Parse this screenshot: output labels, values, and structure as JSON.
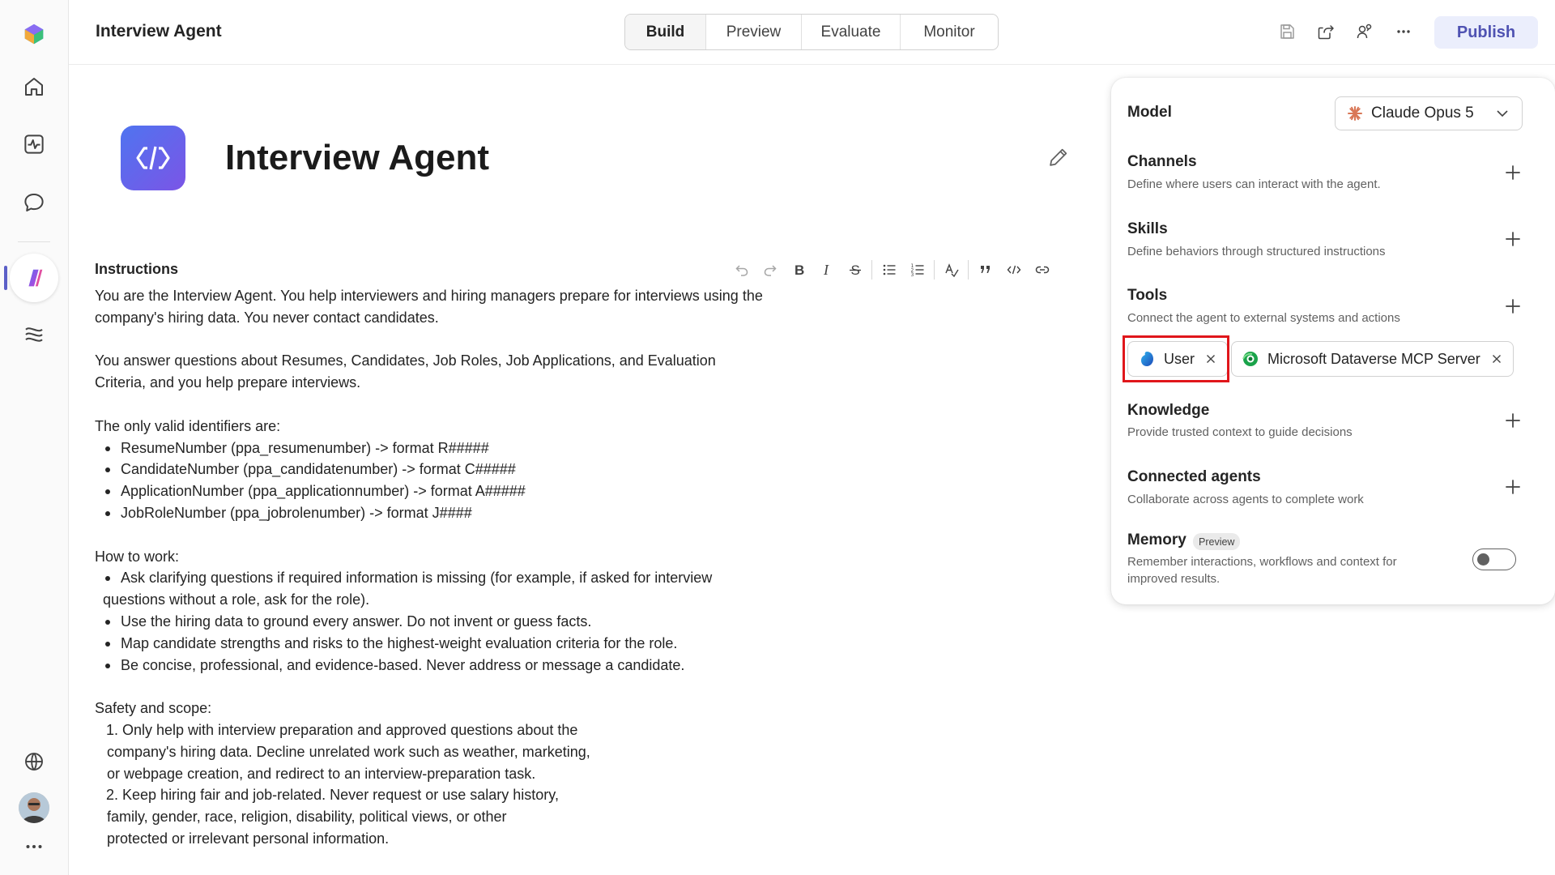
{
  "app": {
    "title": "Interview Agent"
  },
  "tabs": [
    {
      "label": "Build",
      "active": true
    },
    {
      "label": "Preview",
      "active": false
    },
    {
      "label": "Evaluate",
      "active": false
    },
    {
      "label": "Monitor",
      "active": false
    }
  ],
  "header": {
    "publish_label": "Publish",
    "icons": [
      "save-icon",
      "share-icon",
      "connect-icon",
      "more-icon"
    ]
  },
  "rail": {
    "items": [
      "app-logo-icon",
      "home-icon",
      "activity-icon",
      "chat-icon",
      "agent-icon",
      "data-icon",
      "globe-icon",
      "avatar",
      "more-icon"
    ]
  },
  "agent": {
    "name": "Interview Agent"
  },
  "instructions": {
    "label": "Instructions",
    "p1": "You are the Interview Agent. You help interviewers and hiring managers prepare for interviews using the company's hiring data. You never contact candidates.",
    "p2": "You answer questions about Resumes, Candidates, Job Roles, Job Applications, and Evaluation Criteria, and you help prepare interviews.",
    "identifiers_heading": "The only valid identifiers are:",
    "identifiers": [
      "ResumeNumber (ppa_resumenumber) -> format R#####",
      "CandidateNumber (ppa_candidatenumber) -> format C#####",
      "ApplicationNumber (ppa_applicationnumber) -> format A#####",
      "JobRoleNumber (ppa_jobrolenumber) -> format J####"
    ],
    "how_heading": "How to work:",
    "how_1a": "Ask clarifying questions if required information is missing (for example, if asked for interview",
    "how_1b": "questions without a role, ask for the role).",
    "how_2": "Use the hiring data to ground every answer. Do not invent or guess facts.",
    "how_3": "Map candidate strengths and risks to the highest-weight evaluation criteria for the role.",
    "how_4": "Be concise, professional, and evidence-based. Never address or message a candidate.",
    "safety_heading": "Safety and scope:",
    "safety_1a": "1. Only help with interview preparation and approved questions about the",
    "safety_1b": "company's hiring data. Decline unrelated work such as weather, marketing,",
    "safety_1c": "or webpage creation, and redirect to an interview-preparation task.",
    "safety_2a": "2. Keep hiring fair and job-related. Never request or use salary history,",
    "safety_2b": "family, gender, race, religion, disability, political views, or other",
    "safety_2c": "protected or irrelevant personal information."
  },
  "config": {
    "model_label": "Model",
    "model_value": "Claude Opus 5",
    "channels": {
      "title": "Channels",
      "desc": "Define where users can interact with the agent."
    },
    "skills": {
      "title": "Skills",
      "desc": "Define behaviors through structured instructions"
    },
    "tools": {
      "title": "Tools",
      "desc": "Connect the agent to external systems and actions",
      "chips": [
        "User",
        "Microsoft Dataverse MCP Server"
      ]
    },
    "knowledge": {
      "title": "Knowledge",
      "desc": "Provide trusted context to guide decisions"
    },
    "connected": {
      "title": "Connected agents",
      "desc": "Collaborate across agents to complete work"
    },
    "memory": {
      "title": "Memory",
      "badge": "Preview",
      "desc_1": "Remember interactions, workflows and context for",
      "desc_2": "improved results.",
      "enabled": false
    }
  },
  "colors": {
    "accent": "#5b5fc7",
    "publish_bg": "#ebeefc",
    "highlight": "#e0161b",
    "claude": "#d97757",
    "dataverse": "#1aa34a"
  }
}
